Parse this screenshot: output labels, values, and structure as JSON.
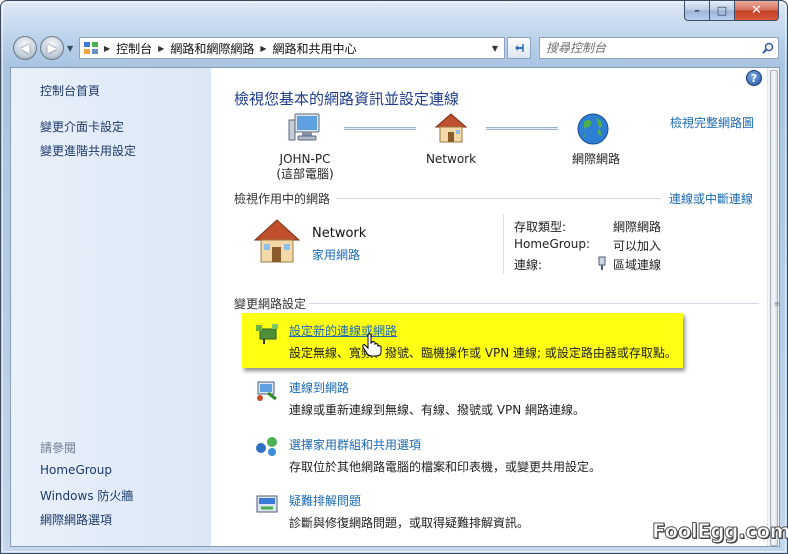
{
  "window": {
    "caption_min": "–",
    "caption_max": "□",
    "caption_close": "✕"
  },
  "address_bar": {
    "segments": [
      "控制台",
      "網路和網際網路",
      "網路和共用中心"
    ]
  },
  "search": {
    "placeholder": "搜尋控制台"
  },
  "sidebar": {
    "home": "控制台首頁",
    "links": [
      "變更介面卡設定",
      "變更進階共用設定"
    ],
    "see_also_heading": "請參閱",
    "see_also": [
      "HomeGroup",
      "Windows 防火牆",
      "網際網路選項"
    ]
  },
  "main": {
    "title": "檢視您基本的網路資訊並設定連線",
    "full_map_link": "檢視完整網路圖",
    "map": {
      "computer_name": "JOHN-PC",
      "computer_sub": "(這部電腦)",
      "network": "Network",
      "internet": "網際網路"
    },
    "active_heading": "檢視作用中的網路",
    "connect_disconnect": "連線或中斷連線",
    "active_network": {
      "name": "Network",
      "type": "家用網路",
      "access_type_label": "存取類型:",
      "access_type_value": "網際網路",
      "homegroup_label": "HomeGroup:",
      "homegroup_value": "可以加入",
      "connection_label": "連線:",
      "connection_value": "區域連線"
    },
    "change_heading": "變更網路設定",
    "tasks": [
      {
        "title": "設定新的連線或網路",
        "desc": "設定無線、寬頻、撥號、臨機操作或 VPN 連線; 或設定路由器或存取點。"
      },
      {
        "title": "連線到網路",
        "desc": "連線或重新連線到無線、有線、撥號或 VPN 網路連線。"
      },
      {
        "title": "選擇家用群組和共用選項",
        "desc": "存取位於其他網路電腦的檔案和印表機，或變更共用設定。"
      },
      {
        "title": "疑難排解問題",
        "desc": "診斷與修復網路問題，或取得疑難排解資訊。"
      }
    ],
    "help": "?"
  },
  "watermark": "FoolEgg.com",
  "colors": {
    "link": "#1b6ab3",
    "title": "#1e3d8b",
    "highlight": "#ffff14",
    "sidebar_bg": "#e0eaf7"
  }
}
